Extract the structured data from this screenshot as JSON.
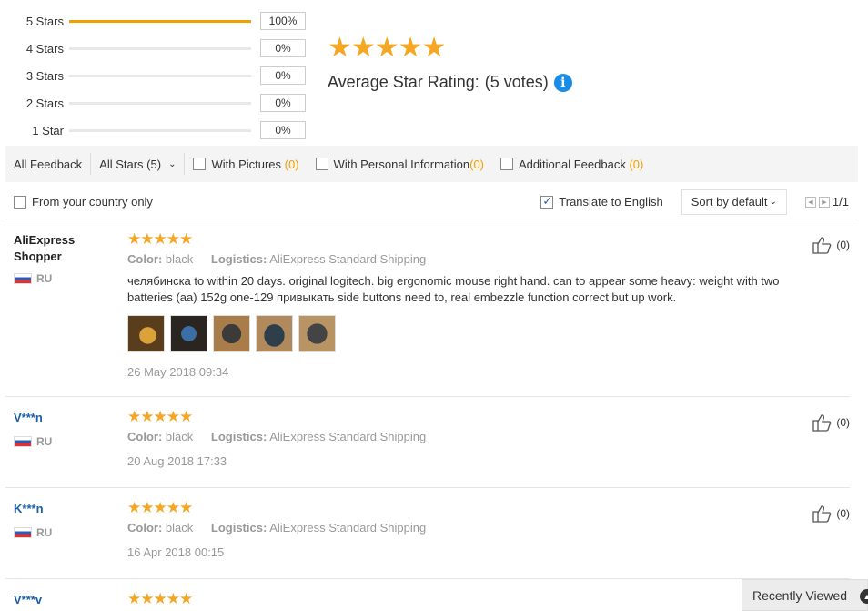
{
  "histogram": [
    {
      "label": "5 Stars",
      "pct": "100%",
      "fill": 1.0
    },
    {
      "label": "4 Stars",
      "pct": "0%",
      "fill": 0
    },
    {
      "label": "3 Stars",
      "pct": "0%",
      "fill": 0
    },
    {
      "label": "2 Stars",
      "pct": "0%",
      "fill": 0
    },
    {
      "label": "1 Star",
      "pct": "0%",
      "fill": 0
    }
  ],
  "summary": {
    "stars": "★★★★★",
    "rating_value": 5,
    "avg_label": "Average Star Rating:",
    "votes": "(5 votes)",
    "info_glyph": "i"
  },
  "filters": {
    "all_feedback": "All Feedback",
    "all_stars": "All Stars (5)",
    "with_pictures": "With Pictures",
    "with_pictures_count": "(0)",
    "with_personal": "With Personal Information",
    "with_personal_count": "(0)",
    "additional": "Additional Feedback",
    "additional_count": "(0)"
  },
  "options": {
    "country_only": "From your country only",
    "translate": "Translate to English",
    "translate_checked": true,
    "sort": "Sort by default",
    "page": "1/1"
  },
  "labels": {
    "color": "Color:",
    "logistics": "Logistics:"
  },
  "reviews": [
    {
      "user": "AliExpress Shopper",
      "country": "RU",
      "stars": "★★★★★",
      "color": "black",
      "logistics": "AliExpress Standard Shipping",
      "text": "челябинска to within 20 days. original logitech. big ergonomic mouse right hand. can to appear some heavy: weight with two batteries (aa) 152g one-129 привыкать side buttons need to, real embezzle function correct but up work.",
      "date": "26 May 2018 09:34",
      "likes": "(0)"
    },
    {
      "user": "V***n",
      "country": "RU",
      "stars": "★★★★★",
      "color": "black",
      "logistics": "AliExpress Standard Shipping",
      "date": "20 Aug 2018 17:33",
      "likes": "(0)"
    },
    {
      "user": "K***n",
      "country": "RU",
      "stars": "★★★★★",
      "color": "black",
      "logistics": "AliExpress Standard Shipping",
      "date": "16 Apr 2018 00:15",
      "likes": "(0)"
    },
    {
      "user": "V***v",
      "stars": "★★★★★"
    }
  ],
  "recently_viewed": "Recently Viewed",
  "colors": {
    "accent_orange": "#f0a000",
    "star": "#f5a623",
    "link": "#1b5fab",
    "info": "#1a8ce6"
  }
}
